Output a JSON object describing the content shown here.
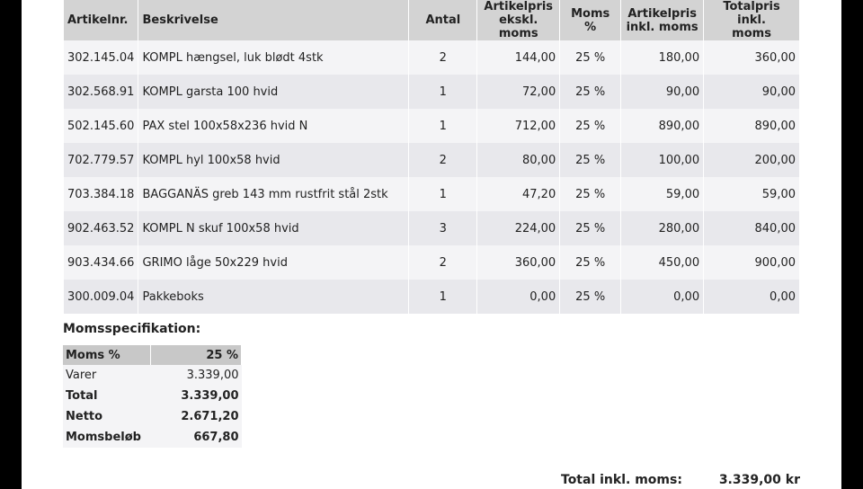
{
  "items_table": {
    "headers": {
      "article_no": "Artikelnr.",
      "description": "Beskrivelse",
      "quantity": "Antal",
      "unit_price_excl_line1": "Artikelpris",
      "unit_price_excl_line2": "ekskl. moms",
      "vat_pct": "Moms %",
      "unit_price_incl_line1": "Artikelpris",
      "unit_price_incl_line2": "inkl. moms",
      "total_incl_line1": "Totalpris inkl.",
      "total_incl_line2": "moms"
    },
    "rows": [
      {
        "article_no": "302.145.04",
        "description": "KOMPL hængsel, luk blødt 4stk",
        "quantity": "2",
        "unit_price_excl": "144,00",
        "vat_pct": "25 %",
        "unit_price_incl": "180,00",
        "total_incl": "360,00"
      },
      {
        "article_no": "302.568.91",
        "description": "KOMPL garsta 100 hvid",
        "quantity": "1",
        "unit_price_excl": "72,00",
        "vat_pct": "25 %",
        "unit_price_incl": "90,00",
        "total_incl": "90,00"
      },
      {
        "article_no": "502.145.60",
        "description": "PAX stel 100x58x236 hvid N",
        "quantity": "1",
        "unit_price_excl": "712,00",
        "vat_pct": "25 %",
        "unit_price_incl": "890,00",
        "total_incl": "890,00"
      },
      {
        "article_no": "702.779.57",
        "description": "KOMPL hyl 100x58 hvid",
        "quantity": "2",
        "unit_price_excl": "80,00",
        "vat_pct": "25 %",
        "unit_price_incl": "100,00",
        "total_incl": "200,00"
      },
      {
        "article_no": "703.384.18",
        "description": "BAGGANÄS greb 143 mm rustfrit stål 2stk",
        "quantity": "1",
        "unit_price_excl": "47,20",
        "vat_pct": "25 %",
        "unit_price_incl": "59,00",
        "total_incl": "59,00"
      },
      {
        "article_no": "902.463.52",
        "description": "KOMPL N skuf 100x58 hvid",
        "quantity": "3",
        "unit_price_excl": "224,00",
        "vat_pct": "25 %",
        "unit_price_incl": "280,00",
        "total_incl": "840,00"
      },
      {
        "article_no": "903.434.66",
        "description": "GRIMO låge 50x229 hvid",
        "quantity": "2",
        "unit_price_excl": "360,00",
        "vat_pct": "25 %",
        "unit_price_incl": "450,00",
        "total_incl": "900,00"
      },
      {
        "article_no": "300.009.04",
        "description": "Pakkeboks",
        "quantity": "1",
        "unit_price_excl": "0,00",
        "vat_pct": "25 %",
        "unit_price_incl": "0,00",
        "total_incl": "0,00"
      }
    ]
  },
  "vat_spec": {
    "title": "Momsspecifikation:",
    "header_label": "Moms %",
    "header_value": "25 %",
    "rows": [
      {
        "label": "Varer",
        "value": "3.339,00",
        "bold": false
      },
      {
        "label": "Total",
        "value": "3.339,00",
        "bold": true
      },
      {
        "label": "Netto",
        "value": "2.671,20",
        "bold": true
      },
      {
        "label": "Momsbeløb",
        "value": "667,80",
        "bold": true
      }
    ]
  },
  "grand_total": {
    "label": "Total inkl. moms:",
    "value": "3.339,00 kr"
  }
}
